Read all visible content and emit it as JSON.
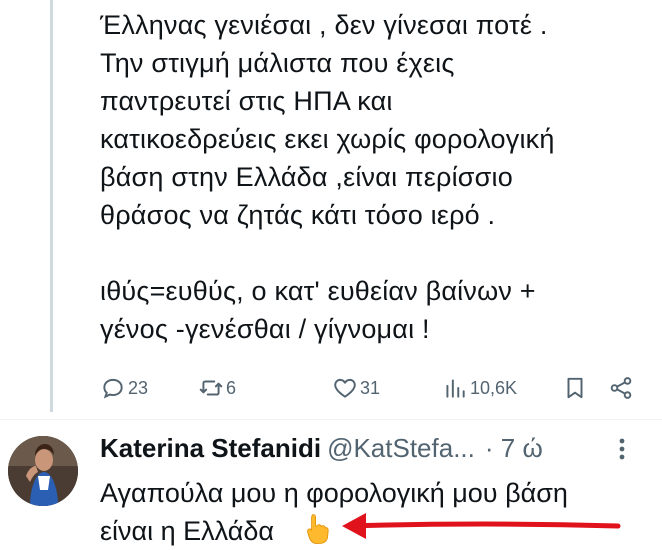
{
  "tweet": {
    "text": "Έλληνας γενιέσαι , δεν γίνεσαι ποτέ .\nΤην στιγμή μάλιστα που έχεις\nπαντρευτεί στις ΗΠΑ και\nκατικοεδρεύεις εκει χωρίς φορολογική\nβάση στην Ελλάδα ,είναι περίσσιο\nθράσος να ζητάς κάτι τόσο ιερό  .\n\nιθύς=ευθύς, ο κατ' ευθείαν βαίνων +\nγένος -γενέσθαι / γίγνομαι !",
    "actions": {
      "replies": "23",
      "reposts": "6",
      "likes": "31",
      "views": "10,6K"
    }
  },
  "reply": {
    "author_name": "Katerina Stefanidi",
    "handle": "@KatStefa...",
    "timestamp": "· 7 ώ",
    "text": "Αγαπούλα μου η φορολογική μου βάση\nείναι η Ελλάδα",
    "emoji": "point-up-finger",
    "annotation_color": "#e0121b"
  },
  "icons": {
    "reply": "speech-bubble-icon",
    "repost": "repost-arrows-icon",
    "like": "heart-icon",
    "views": "bar-chart-icon",
    "bookmark": "bookmark-icon",
    "share": "share-icon",
    "more": "more-dots-icon"
  },
  "colors": {
    "text": "#0f1419",
    "secondary": "#536471",
    "border": "#cfd9de"
  }
}
